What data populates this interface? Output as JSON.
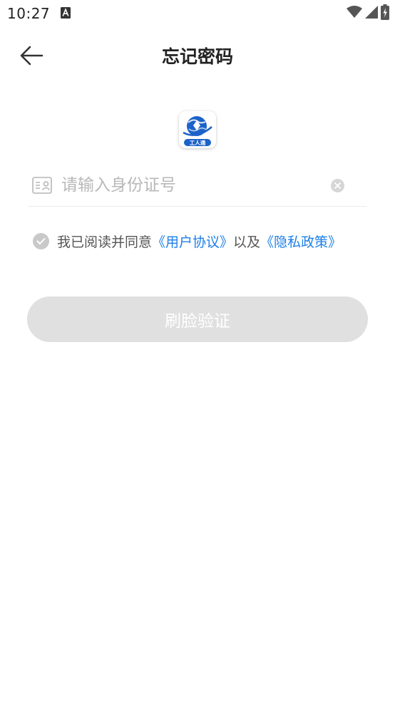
{
  "status_bar": {
    "time": "10:27",
    "notification_icon": "font-a-icon",
    "right_icons": [
      "wifi-icon",
      "signal-icon",
      "battery-charging-icon"
    ]
  },
  "header": {
    "title": "忘记密码",
    "back_icon": "arrow-left-icon"
  },
  "logo": {
    "icon": "app-logo-globe-icon",
    "text": "工人通"
  },
  "form": {
    "id_field": {
      "icon": "id-card-icon",
      "placeholder": "请输入身份证号",
      "value": ""
    },
    "clear_icon": "clear-icon"
  },
  "agreement": {
    "prefix": "我已阅读并同意",
    "user_agreement": "《用户协议》",
    "conjunction": "以及",
    "privacy_policy": "《隐私政策》",
    "checked": false
  },
  "submit": {
    "label": "刷脸验证",
    "enabled": false
  },
  "colors": {
    "link": "#1d7fe8",
    "button_disabled": "#e0e0e0",
    "placeholder": "#b8b8b8",
    "logo_blue": "#1c63c9"
  }
}
